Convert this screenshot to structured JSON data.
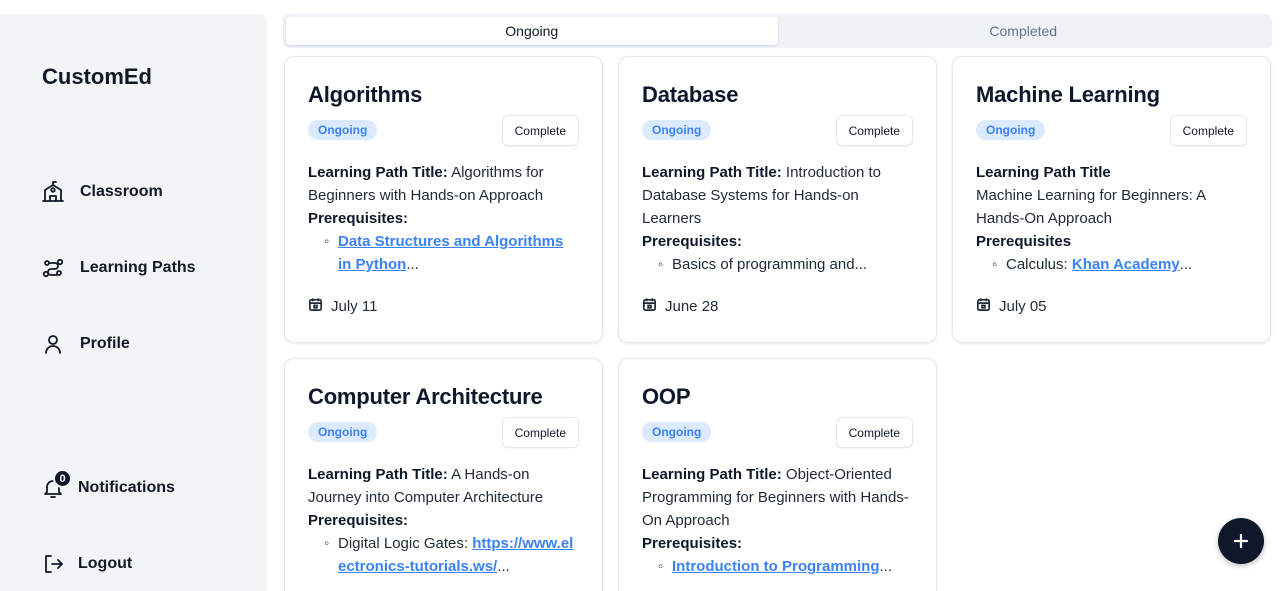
{
  "app": {
    "name": "CustomEd"
  },
  "sidebar": {
    "items": [
      {
        "label": "Classroom",
        "icon": "school-icon"
      },
      {
        "label": "Learning Paths",
        "icon": "route-icon"
      },
      {
        "label": "Profile",
        "icon": "user-icon"
      }
    ],
    "notifications": {
      "label": "Notifications",
      "count": "0"
    },
    "logout": {
      "label": "Logout"
    }
  },
  "tabs": [
    {
      "label": "Ongoing",
      "active": true
    },
    {
      "label": "Completed",
      "active": false
    }
  ],
  "cards": [
    {
      "title": "Algorithms",
      "status": "Ongoing",
      "button": "Complete",
      "lp_label": "Learning Path Title:",
      "lp_title": " Algorithms for Beginners with Hands-on Approach",
      "prereq_label": "Prerequisites:",
      "prereq_prefix": "",
      "prereq_link": "Data Structures and Algorithms in Python",
      "prereq_suffix": "...",
      "date": "July 11"
    },
    {
      "title": "Database",
      "status": "Ongoing",
      "button": "Complete",
      "lp_label": "Learning Path Title:",
      "lp_title": " Introduction to Database Systems for Hands-on Learners",
      "prereq_label": "Prerequisites:",
      "prereq_prefix": "Basics of programming and...",
      "prereq_link": "",
      "prereq_suffix": "",
      "date": "June 28"
    },
    {
      "title": "Machine Learning",
      "status": "Ongoing",
      "button": "Complete",
      "lp_label": "Learning Path Title",
      "lp_title": "Machine Learning for Beginners: A Hands-On Approach",
      "prereq_label": "Prerequisites",
      "prereq_prefix": "Calculus: ",
      "prereq_link": "Khan Academy",
      "prereq_suffix": "...",
      "date": "July 05"
    },
    {
      "title": "Computer Architecture",
      "status": "Ongoing",
      "button": "Complete",
      "lp_label": "Learning Path Title:",
      "lp_title": " A Hands-on Journey into Computer Architecture",
      "prereq_label": "Prerequisites:",
      "prereq_prefix": "Digital Logic Gates: ",
      "prereq_link": "https://www.electronics-tutorials.ws/",
      "prereq_suffix": "...",
      "date": ""
    },
    {
      "title": "OOP",
      "status": "Ongoing",
      "button": "Complete",
      "lp_label": "Learning Path Title:",
      "lp_title": " Object-Oriented Programming for Beginners with Hands-On Approach",
      "prereq_label": "Prerequisites:",
      "prereq_prefix": "",
      "prereq_link": "Introduction to Programming",
      "prereq_suffix": "...",
      "date": ""
    }
  ],
  "colors": {
    "accent": "#3b82f6",
    "badge_bg": "#dbeafe",
    "dark": "#0f172a",
    "sidebar_bg": "#f3f4f6"
  },
  "fab": {
    "icon": "plus-icon"
  }
}
